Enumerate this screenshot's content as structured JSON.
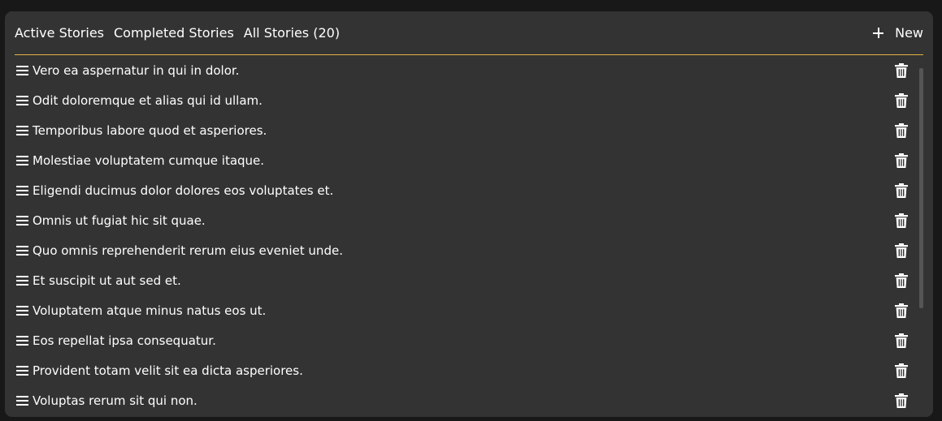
{
  "tabs": {
    "active": "Active Stories",
    "completed": "Completed Stories",
    "all": "All Stories (20)"
  },
  "new_button": {
    "label": "New",
    "icon": "plus-icon"
  },
  "accent_color": "#e3b341",
  "stories": [
    "Vero ea aspernatur in qui in dolor.",
    "Odit doloremque et alias qui id ullam.",
    "Temporibus labore quod et asperiores.",
    "Molestiae voluptatem cumque itaque.",
    "Eligendi ducimus dolor dolores eos voluptates et.",
    "Omnis ut fugiat hic sit quae.",
    "Quo omnis reprehenderit rerum eius eveniet unde.",
    "Et suscipit ut aut sed et.",
    "Voluptatem atque minus natus eos ut.",
    "Eos repellat ipsa consequatur.",
    "Provident totam velit sit ea dicta asperiores.",
    "Voluptas rerum sit qui non."
  ],
  "row_icons": {
    "drag": "drag-handle-icon",
    "delete": "trash-icon"
  }
}
